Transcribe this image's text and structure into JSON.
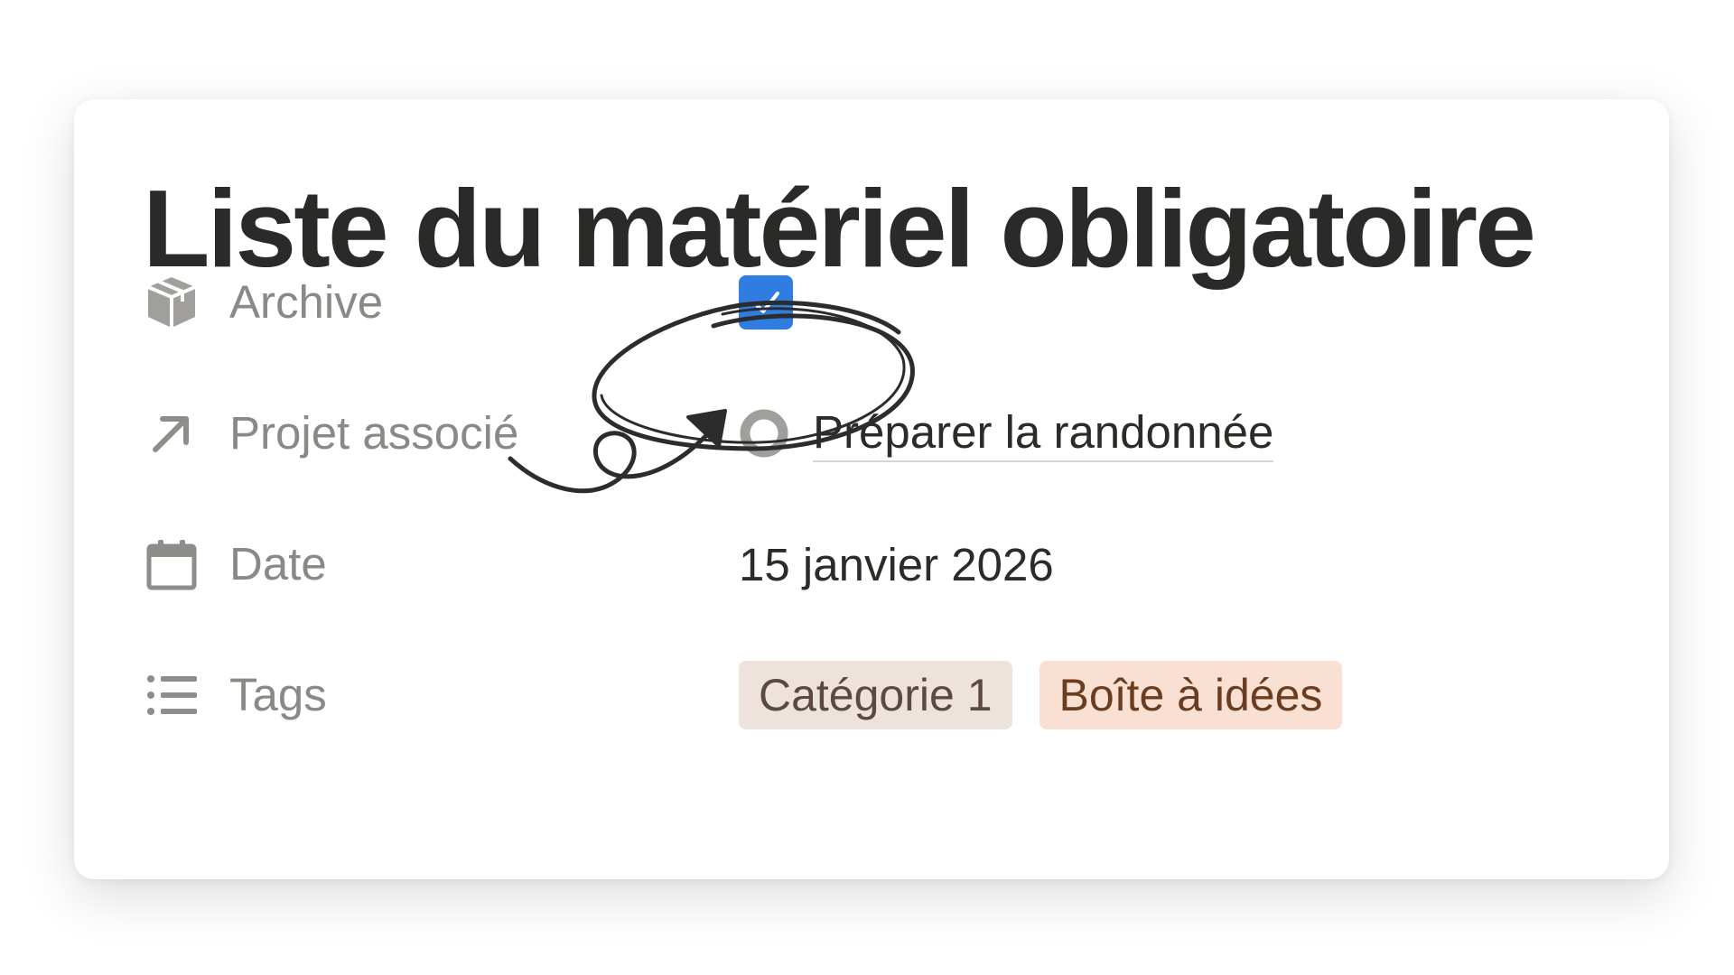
{
  "page": {
    "title": "Liste du matériel obligatoire"
  },
  "properties": [
    {
      "label": "Archive",
      "icon": "archive-box-icon",
      "type": "checkbox",
      "checked": true
    },
    {
      "label": "Projet associé",
      "icon": "arrow-up-right-icon",
      "type": "relation",
      "value": "Préparer la randonnée",
      "value_icon": "circle-icon"
    },
    {
      "label": "Date",
      "icon": "calendar-icon",
      "type": "date",
      "value": "15 janvier 2026"
    },
    {
      "label": "Tags",
      "icon": "list-icon",
      "type": "multi_select",
      "tags": [
        {
          "label": "Catégorie 1",
          "bg": "#eee2dc",
          "color": "#5b4a42"
        },
        {
          "label": "Boîte à idées",
          "bg": "#f9e0d2",
          "color": "#6a3c20"
        }
      ]
    }
  ],
  "colors": {
    "title": "#2a2a28",
    "label": "#8a8985",
    "value": "#2c2b28",
    "checkbox": "#2f7de1",
    "icon": "#a19f9b",
    "annotation": "#2c2c2c"
  }
}
